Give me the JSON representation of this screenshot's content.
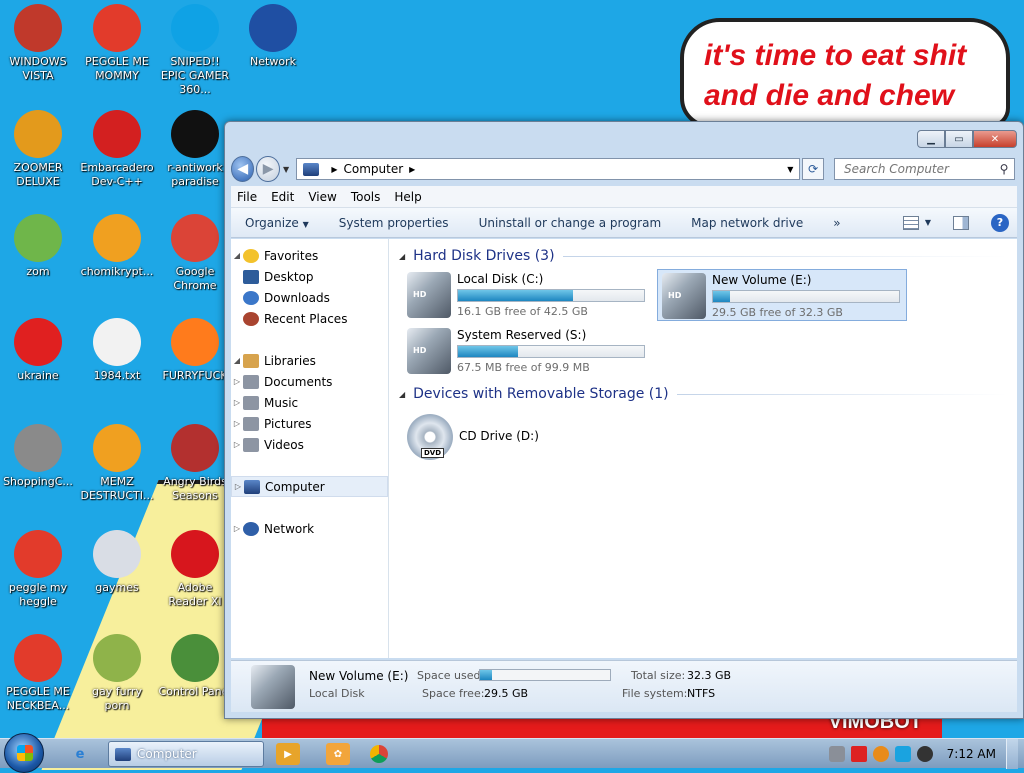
{
  "desktop": {
    "icons": [
      {
        "label": "WINDOWS VISTA",
        "icon": "windows-vista-icon",
        "color": "#c0392b"
      },
      {
        "label": "PEGGLE ME MOMMY",
        "icon": "peggle-icon",
        "color": "#e23b2b"
      },
      {
        "label": "SNIPED!! EPIC GAMER 360...",
        "icon": "skype-icon",
        "color": "#0fa2e5"
      },
      {
        "label": "Network",
        "icon": "network-icon",
        "color": "#1f4fa3"
      },
      {
        "label": "ZOOMER DELUXE",
        "icon": "zuma-icon",
        "color": "#e39a1c"
      },
      {
        "label": "Embarcadero Dev-C++",
        "icon": "devcpp-icon",
        "color": "#d32020"
      },
      {
        "label": "r-antiwork paradise",
        "icon": "antiwork-icon",
        "color": "#111111"
      },
      {
        "label": "zom",
        "icon": "plant-icon",
        "color": "#6fb64a"
      },
      {
        "label": "chomikrypt...",
        "icon": "lock-icon",
        "color": "#f0a020"
      },
      {
        "label": "Google Chrome",
        "icon": "chrome-icon",
        "color": "#db4437"
      },
      {
        "label": "ukraine",
        "icon": "radiation-icon",
        "color": "#e02020"
      },
      {
        "label": "1984.txt",
        "icon": "text-file-icon",
        "color": "#f2f2f2"
      },
      {
        "label": "FURRYFUCK",
        "icon": "firefox-icon",
        "color": "#ff7b1c"
      },
      {
        "label": "ShoppingC...",
        "icon": "flash-icon",
        "color": "#8a8a8a"
      },
      {
        "label": "MEMZ DESTRUCTI...",
        "icon": "lock-icon",
        "color": "#f0a020"
      },
      {
        "label": "Angry Birds Seasons",
        "icon": "angry-birds-icon",
        "color": "#b3302f"
      },
      {
        "label": "peggle my heggle",
        "icon": "peggle-icon",
        "color": "#e23b2b"
      },
      {
        "label": "gaymes",
        "icon": "games-folder-icon",
        "color": "#d9dde5"
      },
      {
        "label": "Adobe Reader XI",
        "icon": "adobe-reader-icon",
        "color": "#d7161d"
      },
      {
        "label": "PEGGLE ME NECKBEA...",
        "icon": "peggle-icon",
        "color": "#e23b2b"
      },
      {
        "label": "gay furry porn",
        "icon": "winrar-icon",
        "color": "#8fb34a"
      },
      {
        "label": "Control Panel",
        "icon": "control-panel-icon",
        "color": "#4a8f3a"
      }
    ],
    "bubble_text": "it's time to eat shit and die and chew",
    "strip_text": "VIMOBOT"
  },
  "window": {
    "address": {
      "crumb": "Computer"
    },
    "search_placeholder": "Search Computer",
    "menu": [
      "File",
      "Edit",
      "View",
      "Tools",
      "Help"
    ],
    "commands": {
      "organize": "Organize",
      "system_properties": "System properties",
      "uninstall": "Uninstall or change a program",
      "map_drive": "Map network drive",
      "more": "»"
    },
    "nav": {
      "favorites": "Favorites",
      "desktop": "Desktop",
      "downloads": "Downloads",
      "recent": "Recent Places",
      "libraries": "Libraries",
      "documents": "Documents",
      "music": "Music",
      "pictures": "Pictures",
      "videos": "Videos",
      "computer": "Computer",
      "network": "Network"
    },
    "groups": {
      "hdd": "Hard Disk Drives (3)",
      "removable": "Devices with Removable Storage (1)"
    },
    "drives": [
      {
        "name": "Local Disk (C:)",
        "free": "16.1 GB free of 42.5 GB",
        "used_fraction": 0.62
      },
      {
        "name": "New Volume (E:)",
        "free": "29.5 GB free of 32.3 GB",
        "used_fraction": 0.09
      },
      {
        "name": "System Reserved (S:)",
        "free": "67.5 MB free of 99.9 MB",
        "used_fraction": 0.32
      }
    ],
    "cd": {
      "name": "CD Drive (D:)",
      "badge": "DVD"
    },
    "details": {
      "name": "New Volume (E:)",
      "type": "Local Disk",
      "space_used_label": "Space used:",
      "space_free_label": "Space free:",
      "space_free": "29.5 GB",
      "total_label": "Total size:",
      "total": "32.3 GB",
      "fs_label": "File system:",
      "fs": "NTFS",
      "used_fraction": 0.09
    }
  },
  "taskbar": {
    "task_label": "Computer",
    "clock": "7:12 AM"
  }
}
